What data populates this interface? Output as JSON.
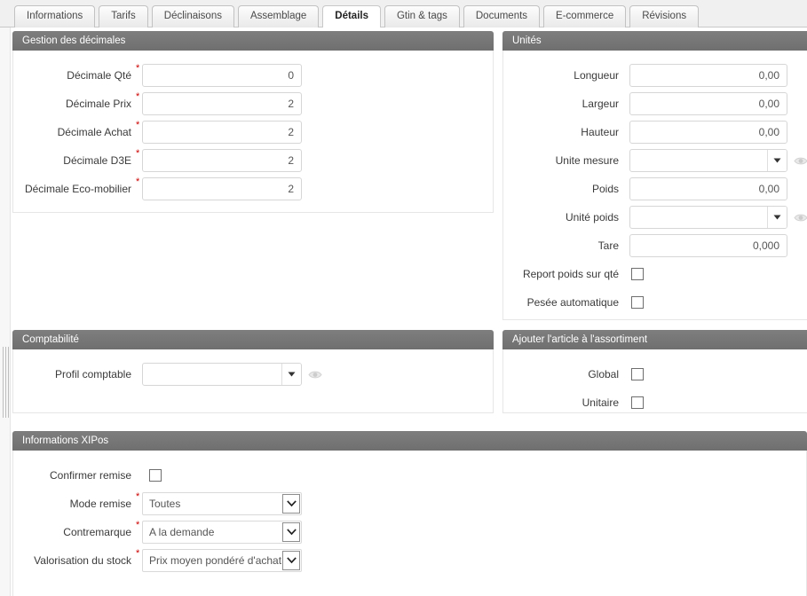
{
  "tabs": [
    {
      "label": "Informations",
      "active": false
    },
    {
      "label": "Tarifs",
      "active": false
    },
    {
      "label": "Déclinaisons",
      "active": false
    },
    {
      "label": "Assemblage",
      "active": false
    },
    {
      "label": "Détails",
      "active": true
    },
    {
      "label": "Gtin & tags",
      "active": false
    },
    {
      "label": "Documents",
      "active": false
    },
    {
      "label": "E-commerce",
      "active": false
    },
    {
      "label": "Révisions",
      "active": false
    }
  ],
  "panels": {
    "decimales": {
      "title": "Gestion des décimales",
      "fields": [
        {
          "label": "Décimale Qté",
          "value": "0",
          "required": true
        },
        {
          "label": "Décimale Prix",
          "value": "2",
          "required": true
        },
        {
          "label": "Décimale Achat",
          "value": "2",
          "required": true
        },
        {
          "label": "Décimale D3E",
          "value": "2",
          "required": true
        },
        {
          "label": "Décimale Eco-mobilier",
          "value": "2",
          "required": true
        }
      ]
    },
    "unites": {
      "title": "Unités",
      "fields": [
        {
          "label": "Longueur",
          "value": "0,00",
          "type": "text"
        },
        {
          "label": "Largeur",
          "value": "0,00",
          "type": "text"
        },
        {
          "label": "Hauteur",
          "value": "0,00",
          "type": "text"
        },
        {
          "label": "Unite mesure",
          "value": "",
          "type": "combo"
        },
        {
          "label": "Poids",
          "value": "0,00",
          "type": "text"
        },
        {
          "label": "Unité poids",
          "value": "",
          "type": "combo"
        },
        {
          "label": "Tare",
          "value": "0,000",
          "type": "text"
        },
        {
          "label": "Report poids sur qté",
          "value": "",
          "type": "checkbox",
          "checked": false
        },
        {
          "label": "Pesée automatique",
          "value": "",
          "type": "checkbox",
          "checked": false
        }
      ]
    },
    "comptabilite": {
      "title": "Comptabilité",
      "fields": [
        {
          "label": "Profil comptable",
          "value": "",
          "type": "combo"
        }
      ]
    },
    "assortiment": {
      "title": "Ajouter l'article à l'assortiment",
      "fields": [
        {
          "label": "Global",
          "value": "",
          "type": "checkbox",
          "checked": false
        },
        {
          "label": "Unitaire",
          "value": "",
          "type": "checkbox",
          "checked": false
        }
      ]
    },
    "xipos": {
      "title": "Informations XIPos",
      "fields": [
        {
          "label": "Confirmer remise",
          "value": "",
          "type": "checkbox",
          "checked": false,
          "required": false
        },
        {
          "label": "Mode remise",
          "value": "Toutes",
          "type": "select",
          "required": true
        },
        {
          "label": "Contremarque",
          "value": "A la demande",
          "type": "select",
          "required": true
        },
        {
          "label": "Valorisation du stock",
          "value": "Prix moyen pondéré d'achat",
          "type": "select",
          "required": true
        }
      ]
    }
  },
  "icons": {
    "eye": "eye-icon",
    "chevron_down": "chevron-down-icon"
  },
  "colors": {
    "panel_header": "#757575",
    "required_star": "#cc0000",
    "page_bg": "#ffffff",
    "tabbar_bg": "#f0f0f0",
    "input_border": "#d6d6d6"
  }
}
